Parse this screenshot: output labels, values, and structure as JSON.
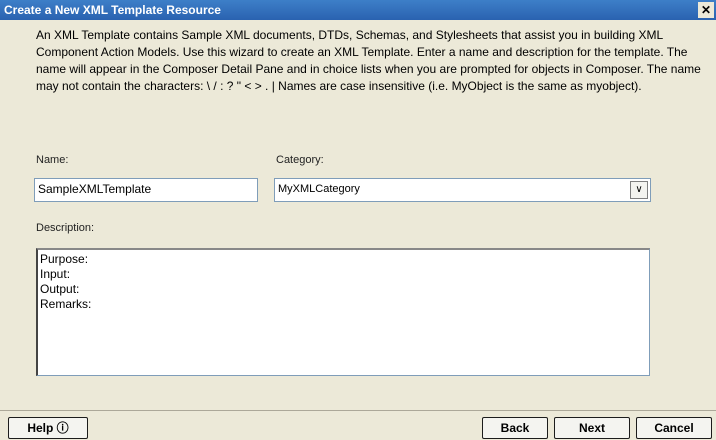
{
  "window": {
    "title": "Create a New XML Template Resource",
    "close_glyph": "✕"
  },
  "intro_text": "An XML Template contains Sample XML documents, DTDs, Schemas, and Stylesheets that assist you in building XML Component Action Models.  Use this wizard to create an XML Template.  Enter a name and description for the template.  The name will appear in the Composer Detail Pane and in choice lists when you are prompted for objects in Composer.  The name may not contain the characters: \\ / : ? \" < > . |  Names are case insensitive (i.e. MyObject is the same as myobject).",
  "form": {
    "name_label": "Name:",
    "name_value": "SampleXMLTemplate",
    "category_label": "Category:",
    "category_value": "MyXMLCategory",
    "description_label": "Description:",
    "description_lines": [
      "Purpose:",
      "Input:",
      "Output:",
      "Remarks:"
    ]
  },
  "buttons": {
    "help": "Help ⓘ",
    "back": "Back",
    "next": "Next",
    "cancel": "Cancel"
  },
  "icons": {
    "dropdown": "chevron-down-icon",
    "close": "close-icon"
  }
}
